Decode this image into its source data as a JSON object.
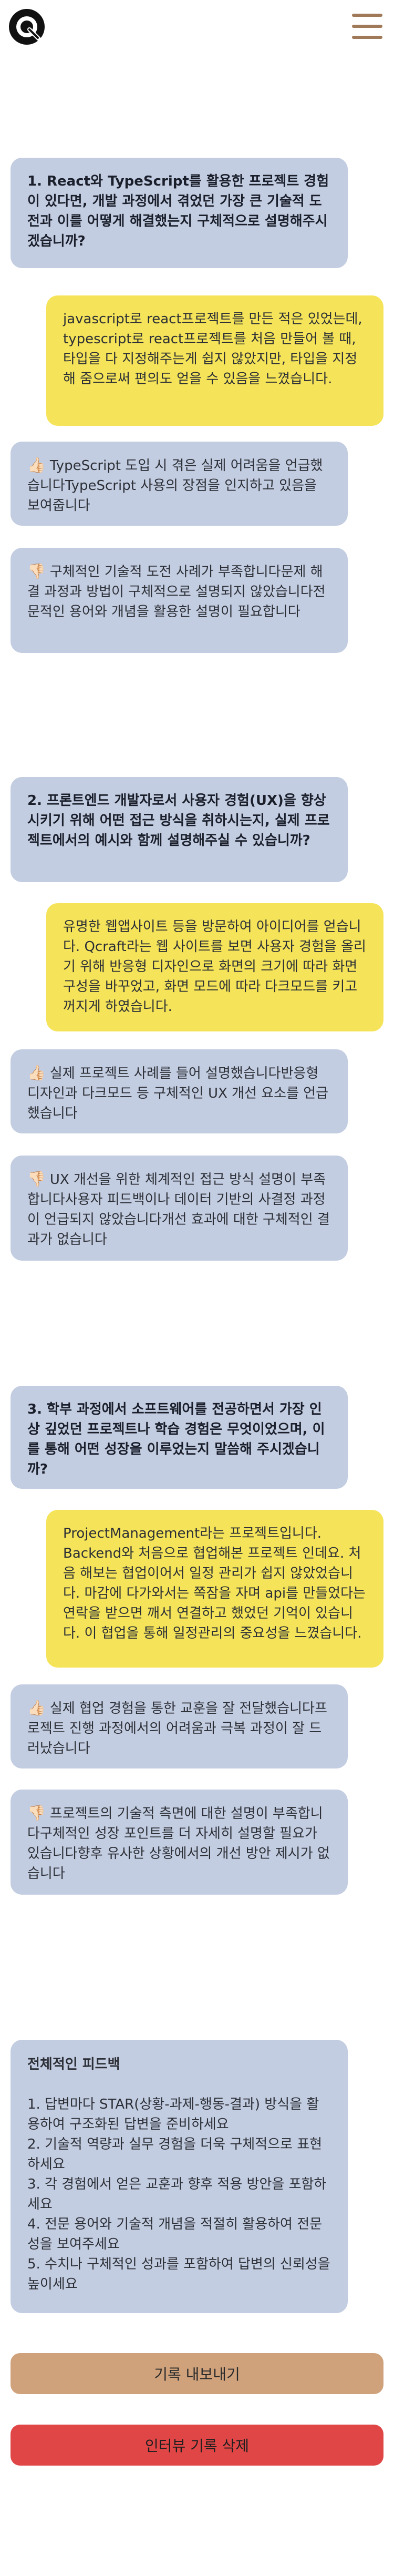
{
  "header": {
    "logo_letter": "Q"
  },
  "q1": {
    "question": "1. React와 TypeScript를 활용한 프로젝트 경험이 있다면, 개발 과정에서 겪었던 가장 큰 기술적 도전과 이를 어떻게 해결했는지 구체적으로 설명해주시겠습니까?",
    "answer": "javascript로 react프로젝트를 만든 적은 있었는데, typescript로 react프로젝트를 처음 만들어 볼 때, 타입을 다 지정해주는게 쉽지 않았지만, 타입을 지정해 줌으로써 편의도 얻을 수 있음을 느꼈습니다.",
    "good_icon": "👍🏻",
    "good": "TypeScript 도입 시 겪은 실제 어려움을 언급했습니다TypeScript 사용의 장점을 인지하고 있음을 보여줍니다",
    "bad_icon": "👎🏻",
    "bad": "구체적인 기술적 도전 사례가 부족합니다문제 해결 과정과 방법이 구체적으로 설명되지 않았습니다전문적인 용어와 개념을 활용한 설명이 필요합니다"
  },
  "q2": {
    "question": "2. 프론트엔드 개발자로서 사용자 경험(UX)을 향상시키기 위해 어떤 접근 방식을 취하시는지, 실제 프로젝트에서의 예시와 함께 설명해주실 수 있습니까?",
    "answer": "유명한 웹앱사이트 등을 방문하여 아이디어를 얻습니다. Qcraft라는 웹 사이트를 보면 사용자 경험을 올리기 위해 반응형 디자인으로 화면의 크기에 따라 화면 구성을 바꾸었고, 화면 모드에 따라 다크모드를 키고 꺼지게 하였습니다.",
    "good_icon": "👍🏻",
    "good": "실제 프로젝트 사례를 들어 설명했습니다반응형 디자인과 다크모드 등 구체적인 UX 개선 요소를 언급했습니다",
    "bad_icon": "👎🏻",
    "bad": "UX 개선을 위한 체계적인 접근 방식 설명이 부족합니다사용자 피드백이나 데이터 기반의 사결정 과정이 언급되지 않았습니다개선 효과에 대한 구체적인 결과가 없습니다"
  },
  "q3": {
    "question": "3. 학부 과정에서 소프트웨어를 전공하면서 가장 인상 깊었던 프로젝트나 학습 경험은 무엇이었으며, 이를 통해 어떤 성장을 이루었는지 말씀해 주시겠습니까?",
    "answer": "ProjectManagement라는 프로젝트입니다. Backend와 처음으로 협업해본 프로젝트 인데요. 처음 해보는 협업이어서 일정 관리가 쉽지 않았었습니다. 마감에 다가와서는 쪽잠을 자며 api를 만들었다는 연락을 받으면 깨서 연결하고 했었던 기억이 있습니다. 이 협업을 통해 일정관리의 중요성을 느꼈습니다.",
    "good_icon": "👍🏻",
    "good": "실제 협업 경험을 통한 교훈을 잘 전달했습니다프로젝트 진행 과정에서의 어려움과 극복 과정이 잘 드러났습니다",
    "bad_icon": "👎🏻",
    "bad": "프로젝트의 기술적 측면에 대한 설명이 부족합니다구체적인 성장 포인트를 더 자세히 설명할 필요가 있습니다향후 유사한 상황에서의 개선 방안 제시가 없습니다"
  },
  "summary": {
    "title": "전체적인 피드백",
    "items": [
      "1. 답변마다 STAR(상황-과제-행동-결과) 방식을 활용하여 구조화된 답변을 준비하세요",
      "2. 기술적 역량과 실무 경험을 더욱 구체적으로 표현하세요",
      "3. 각 경험에서 얻은 교훈과 향후 적용 방안을 포함하세요",
      "4. 전문 용어와 기술적 개념을 적절히 활용하여 전문성을 보여주세요",
      "5. 수치나 구체적인 성과를 포함하여 답변의 신뢰성을 높이세요"
    ]
  },
  "buttons": {
    "export_label": "기록 내보내기",
    "delete_label": "인터뷰 기록 삭제"
  },
  "colors": {
    "question_bg": "#c3cde1",
    "answer_bg": "#f5e459",
    "export_btn": "#cfa27c",
    "delete_btn": "#e04646",
    "menu_icon": "#a07a58"
  }
}
